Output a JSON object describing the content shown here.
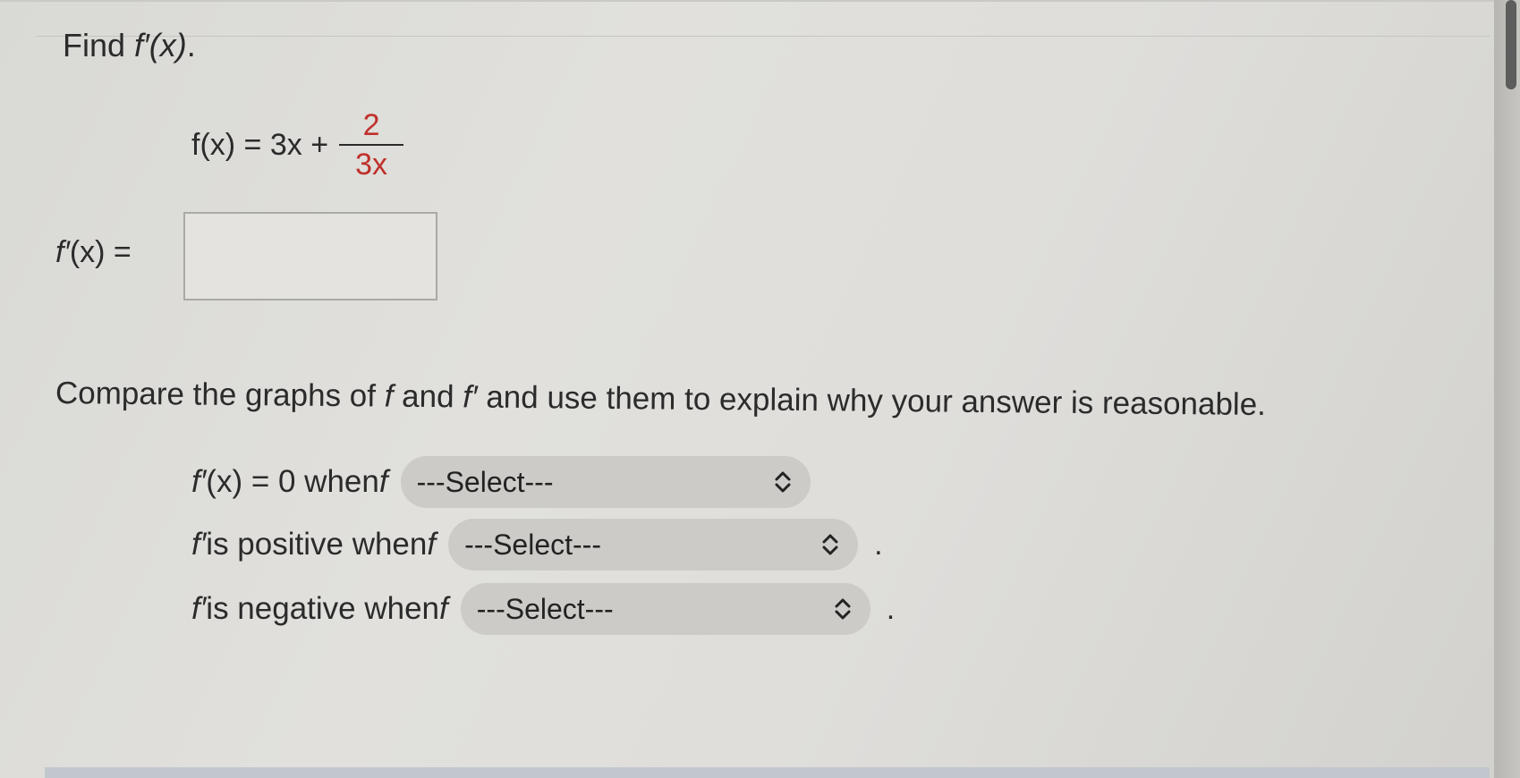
{
  "question1": {
    "prefix": "Find ",
    "fprime": "f′(x)",
    "suffix": "."
  },
  "function": {
    "lhs": "f(x) = 3x + ",
    "numerator": "2",
    "denominator": "3x"
  },
  "answer": {
    "label_fn": "f′",
    "label_rest": "(x) = ",
    "value": ""
  },
  "question2": {
    "text_a": "Compare the graphs of ",
    "f": "f",
    "text_b": " and ",
    "fprime": "f′",
    "text_c": " and use them to explain why your answer is reasonable."
  },
  "statements": [
    {
      "fn": "f′",
      "text": "(x) = 0 when ",
      "f": "f",
      "select": "---Select---",
      "end": ""
    },
    {
      "fn": "f′",
      "text": " is positive when ",
      "f": "f",
      "select": "---Select---",
      "end": "."
    },
    {
      "fn": "f′",
      "text": " is negative when ",
      "f": "f",
      "select": "---Select---",
      "end": "."
    }
  ],
  "colors": {
    "fraction": "#c0302b",
    "select_bg": "#cccbc7"
  },
  "icons": {
    "select": "up-down-chevron-icon"
  }
}
